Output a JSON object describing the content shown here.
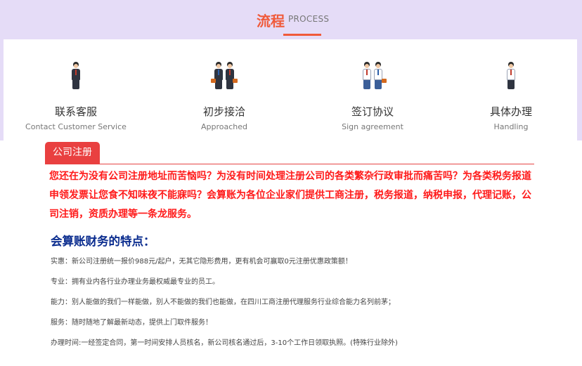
{
  "section": {
    "title_cn": "流程",
    "title_en": "PROCESS",
    "accent_color": "#f05a3a",
    "band_color": "#e5dcf7"
  },
  "steps": [
    {
      "name_cn": "联系客服",
      "name_en": "Contact Customer Service",
      "icon": "businessman-icon"
    },
    {
      "name_cn": "初步接洽",
      "name_en": "Approached",
      "icon": "two-businessmen-icon"
    },
    {
      "name_cn": "签订协议",
      "name_en": "Sign agreement",
      "icon": "handshake-icon"
    },
    {
      "name_cn": "具体办理",
      "name_en": "Handling",
      "icon": "clerk-icon"
    }
  ],
  "tab": {
    "label": "公司注册",
    "color": "#e94040"
  },
  "intro": {
    "text": "您还在为没有公司注册地址而苦恼吗？为没有时间处理注册公司的各类繁杂行政审批而痛苦吗？为各类税务报道申领发票让您食不知味夜不能寐吗？会算账为各位企业家们提供工商注册，税务报道，纳税申报，代理记账，公司注销，资质办理等一条龙服务。",
    "color": "#ff1a1a"
  },
  "features": {
    "title": "会算账财务的特点：",
    "title_color": "#0b2d8f",
    "items": [
      "实惠：新公司注册统一报价988元/起户，无其它隐形费用，更有机会可赢取0元注册优惠政策额！",
      "专业：拥有业内各行业办理业务最权威最专业的员工。",
      "能力：别人能做的我们一样能做，别人不能做的我们也能做，在四川工商注册代理服务行业综合能力名列前茅；",
      "服务：随时随地了解最新动态，提供上门取件服务！",
      "办理时间:一经签定合同，第一时间安排人员核名，新公司核名通过后，3-10个工作日领取执照。(特殊行业除外)"
    ]
  }
}
